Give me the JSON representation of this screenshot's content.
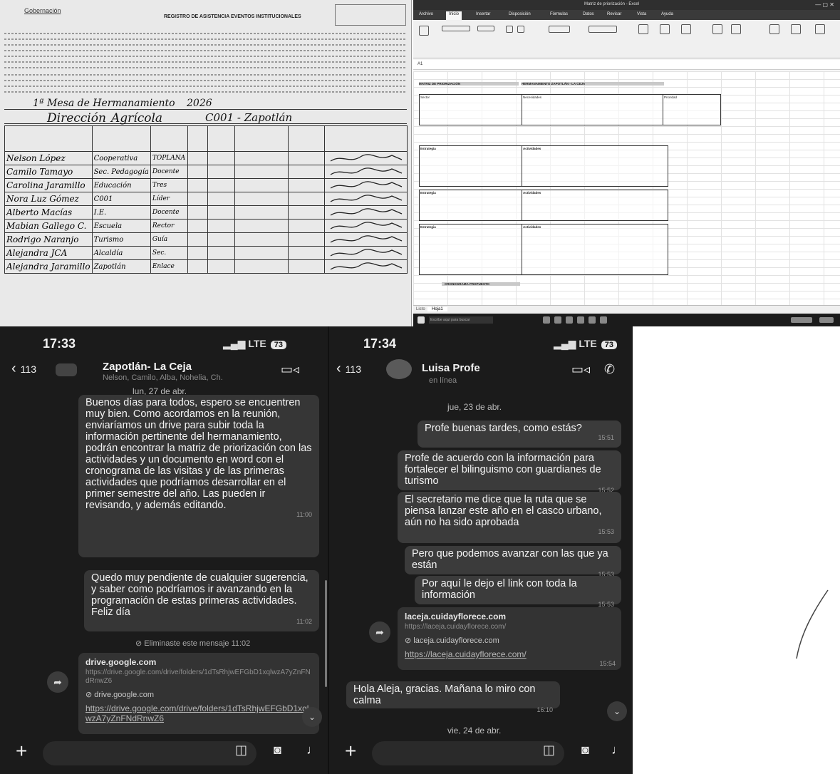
{
  "attendance_sheet": {
    "org_label": "Gobernación",
    "title": "REGISTRO DE ASISTENCIA EVENTOS INSTITUCIONALES",
    "event_line": "1ª Mesa de Hermanamiento",
    "year_line": "2026",
    "dependency": "Dirección",
    "place": "Agrícola",
    "code": "C001 - Zapotlán",
    "rows": [
      {
        "name": "Nelson López",
        "entity": "Cooperativa",
        "role": "TOPLANA"
      },
      {
        "name": "Camilo Tamayo",
        "entity": "Sec. Pedagogía",
        "role": "Docente"
      },
      {
        "name": "Carolina Jaramillo",
        "entity": "Educación",
        "role": "Tres"
      },
      {
        "name": "Nora Luz Gómez",
        "entity": "C001",
        "role": "Líder"
      },
      {
        "name": "Alberto Macías",
        "entity": "I.E.",
        "role": "Docente"
      },
      {
        "name": "Mabian Gallego C.",
        "entity": "Escuela",
        "role": "Rector"
      },
      {
        "name": "Rodrigo Naranjo",
        "entity": "Turismo",
        "role": "Guía"
      },
      {
        "name": "Alejandra JCA",
        "entity": "Alcaldía",
        "role": "Sec."
      },
      {
        "name": "Alejandra Jaramillo",
        "entity": "Zapotlán",
        "role": "Enlace"
      }
    ]
  },
  "excel": {
    "window_title": "Matriz de priorización - Excel",
    "tabs": [
      "Archivo",
      "Inicio",
      "Insertar",
      "Disposición",
      "Fórmulas",
      "Datos",
      "Revisar",
      "Vista",
      "Ayuda"
    ],
    "name_box": "A1",
    "header_left": "MATRIZ DE PRIORIZACIÓN",
    "header_right": "HERMANAMIENTO ZAPOTLÁN - LA CEJA",
    "col_a_label": "Sector",
    "col_b_label": "Necesidades",
    "col_c_label": "Prioridad",
    "block1_left": "Estrategia",
    "block2_left": "Estrategia",
    "block3_left": "Estrategia",
    "block_right_label": "Actividades",
    "footer_label": "CRONOGRAMA PROPUESTO",
    "sheet_tab": "Hoja1",
    "status_ready": "Listo",
    "taskbar_search": "Escribe aquí para buscar"
  },
  "chat1": {
    "time": "17:33",
    "network": "LTE",
    "battery": "73",
    "back_count": "113",
    "name": "Zapotlán- La Ceja",
    "members": "Nelson, Camilo, Alba, Nohelia, Ch.",
    "date": "lun, 27 de abr.",
    "msg1": "Buenos días para todos, espero se encuentren muy bien. Como acordamos en la reunión, enviaríamos un drive para subir toda la información pertinente del hermanamiento, podrán encontrar la matriz de priorización con las actividades y un documento en word con el cronograma de las visitas y de las primeras actividades que podríamos desarrollar en el primer semestre del año. Las pueden ir revisando, y además editando.",
    "msg1_time": "11:00",
    "msg2": "Quedo muy pendiente de cualquier sugerencia, y saber como podríamos ir avanzando en la programación de estas primeras actividades. Feliz día",
    "msg2_time": "11:02",
    "deleted": "Eliminaste este mensaje",
    "deleted_time": "11:02",
    "link_title": "drive.google.com",
    "link_url": "https://drive.google.com/drive/folders/1dTsRhjwEFGbD1xqlwzA7yZnFNdRnwZ6",
    "link_domain": "drive.google.com",
    "link_text": "https://drive.google.com/drive/folders/1dTsRhjwEFGbD1xqlwzA7yZnFNdRnwZ6"
  },
  "chat2": {
    "time": "17:34",
    "network": "LTE",
    "battery": "73",
    "back_count": "113",
    "name": "Luisa Profe",
    "sub": "en línea",
    "date1": "jue, 23 de abr.",
    "m1": "Profe buenas tardes, como estás?",
    "m1_time": "15:51",
    "m2": "Profe de acuerdo con la información para fortalecer el bilinguismo con guardianes de turismo",
    "m2_time": "15:52",
    "m3": "El secretario me dice que la ruta que se piensa lanzar este año en el casco urbano, aún no ha sido aprobada",
    "m3_time": "15:53",
    "m4": "Pero que podemos avanzar con las que ya están",
    "m4_time": "15:53",
    "m5": "Por aquí le dejo el link con toda la información",
    "m5_time": "15:53",
    "link_title": "laceja.cuidayflorece.com",
    "link_url": "https://laceja.cuidayflorece.com/",
    "link_domain": "laceja.cuidayflorece.com",
    "link_text": "https://laceja.cuidayflorece.com/",
    "link_time": "15:54",
    "reply": "Hola Aleja, gracias. Mañana lo miro con calma",
    "reply_time": "16:10",
    "date2": "vie, 24 de abr."
  }
}
